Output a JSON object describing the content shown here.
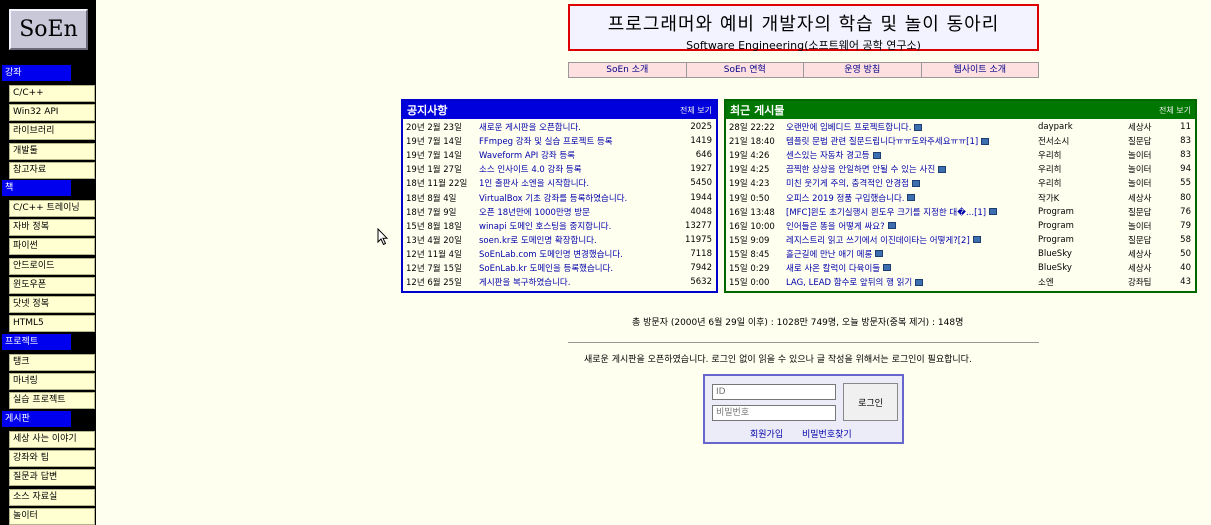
{
  "logo": "SoEn",
  "sidebar": [
    {
      "heading": "강좌",
      "items": [
        "C/C++",
        "Win32 API",
        "라이브러리",
        "개발툴",
        "참고자료"
      ]
    },
    {
      "heading": "책",
      "items": [
        "C/C++ 트레이닝",
        "자바 정복",
        "파이썬",
        "안드로이드",
        "윈도우폰",
        "닷넷 정복",
        "HTML5"
      ]
    },
    {
      "heading": "프로젝트",
      "items": [
        "탱크",
        "마녀링",
        "실습 프로젝트"
      ]
    },
    {
      "heading": "게시판",
      "items": [
        "세상 사는 이야기",
        "강좌와 팁",
        "질문과 답변",
        "소스 자료실",
        "놀이터"
      ]
    }
  ],
  "banner": {
    "title": "프로그래머와 예비 개발자의 학습 및 놀이 동아리",
    "subtitle": "Software Engineering(소프트웨어 공학 연구소)"
  },
  "nav": [
    "SoEn 소개",
    "SoEn 연혁",
    "운영 방침",
    "웹사이트 소개"
  ],
  "notice_board": {
    "title": "공지사항",
    "more": "전체 보기",
    "rows": [
      {
        "date": "20년 2월 23일",
        "title": "새로운 게시판을 오픈합니다.",
        "count": "2025"
      },
      {
        "date": "19년 7월 14일",
        "title": "FFmpeg 강좌 및 실습 프로젝트 등록",
        "count": "1419"
      },
      {
        "date": "19년 7월 14일",
        "title": "Waveform API 강좌 등록",
        "count": "646"
      },
      {
        "date": "19년 1월 27일",
        "title": "소스 인사이트 4.0 강좌 등록",
        "count": "1927"
      },
      {
        "date": "18년 11월 22일",
        "title": "1인 출판사 소엔을 시작합니다.",
        "count": "5450"
      },
      {
        "date": "18년 8월 4일",
        "title": "VirtualBox 기초 강좌를 등록하였습니다.",
        "count": "1944"
      },
      {
        "date": "18년 7월 9일",
        "title": "오픈 18년만에 1000만명 방문",
        "count": "4048"
      },
      {
        "date": "15년 8월 18일",
        "title": "winapi 도메인 호스팅을 중지합니다.",
        "count": "13277"
      },
      {
        "date": "13년 4월 20일",
        "title": "soen.kr로 도메인명 확장합니다.",
        "count": "11975"
      },
      {
        "date": "12년 11월 4일",
        "title": "SoEnLab.com 도메인명 변경했습니다.",
        "count": "7118"
      },
      {
        "date": "12년 7월 15일",
        "title": "SoEnLab.kr 도메인을 등록했습니다.",
        "count": "7942"
      },
      {
        "date": "12년 6월 25일",
        "title": "게시판을 복구하였습니다.",
        "count": "5632"
      }
    ]
  },
  "recent_board": {
    "title": "최근 게시물",
    "more": "전체 보기",
    "rows": [
      {
        "date": "28일 22:22",
        "title": "오랜만에 임베디드 프로젝트합니다.",
        "author": "daypark",
        "board": "세상사",
        "count": "11"
      },
      {
        "date": "21일 18:40",
        "title": "템플릿 문법 관련 질문드립니다ㅠㅠ도와주세요ㅠㅠ[1]",
        "author": "전서소시",
        "board": "질문답",
        "count": "83"
      },
      {
        "date": "19일 4:26",
        "title": "센스있는 자동차 경고등",
        "author": "우리히",
        "board": "놀이터",
        "count": "83"
      },
      {
        "date": "19일 4:25",
        "title": "끔찍한 상상을 안일하면 안될 수 있는 사진",
        "author": "우리히",
        "board": "놀이터",
        "count": "94"
      },
      {
        "date": "19일 4:23",
        "title": "미친 웃기게 주의, 충격적인 안경점",
        "author": "우리히",
        "board": "놀이터",
        "count": "55"
      },
      {
        "date": "19일 0:50",
        "title": "오피스 2019 정품 구입했습니다.",
        "author": "작가K",
        "board": "세상사",
        "count": "80"
      },
      {
        "date": "16일 13:48",
        "title": "[MFC]윈도 초기실행시 윈도우 크기를 지정한 대�...[1]",
        "author": "Program",
        "board": "질문답",
        "count": "76"
      },
      {
        "date": "16일 10:00",
        "title": "인어들은 똥을 어떻게 싸요?",
        "author": "Program",
        "board": "놀이터",
        "count": "79"
      },
      {
        "date": "15일 9:09",
        "title": "레지스트리 읽고 쓰기에서 이진데이타는 어떻게?[2]",
        "author": "Program",
        "board": "질문답",
        "count": "58"
      },
      {
        "date": "15일 8:45",
        "title": "흘근길에 만난 애기 메롱",
        "author": "BlueSky",
        "board": "세상사",
        "count": "50"
      },
      {
        "date": "15일 0:29",
        "title": "새로 사온 칼럭이 다육이들",
        "author": "BlueSky",
        "board": "세상사",
        "count": "40"
      },
      {
        "date": "15일 0:00",
        "title": "LAG, LEAD 함수로 앞뒤의 행 읽기",
        "author": "소엔",
        "board": "강좌팁",
        "count": "43"
      }
    ]
  },
  "visitors": "총 방문자 (2000년 6월 29일 이후) : 1028만 749명, 오늘 방문자(중복 제거) : 148명",
  "notice_message": "새로운 게시판을 오픈하였습니다. 로그인 없이 읽을 수 있으나 글 작성을 위해서는 로그인이 필요합니다.",
  "login": {
    "id_placeholder": "ID",
    "pw_placeholder": "비밀번호",
    "button": "로그인",
    "signup": "회원가입",
    "find_password": "비밀번호찾기"
  }
}
